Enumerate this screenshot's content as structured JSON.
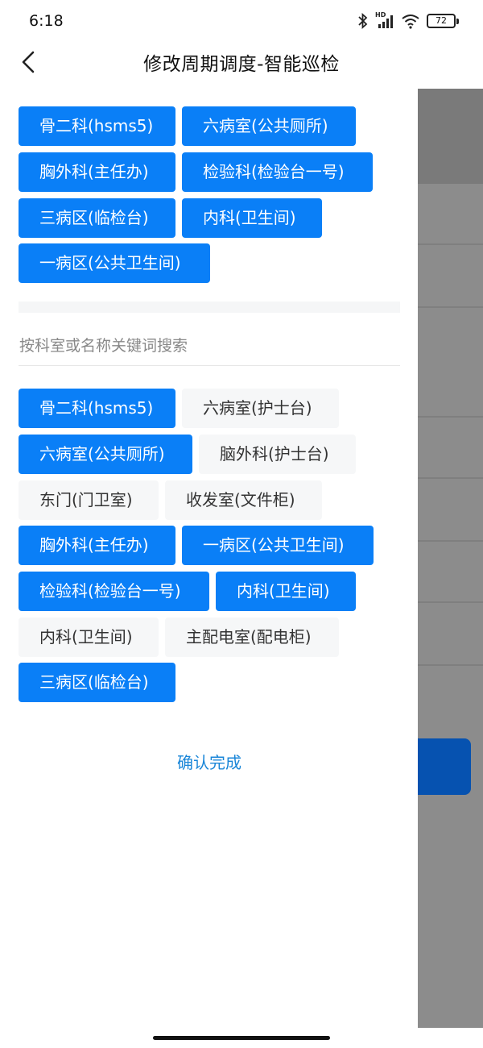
{
  "status": {
    "time": "6:18",
    "battery": "72",
    "network_badge": "HD"
  },
  "header": {
    "title": "修改周期调度-智能巡检"
  },
  "selected_chips": [
    "骨二科(hsms5)",
    "六病室(公共厕所)",
    "胸外科(主任办)",
    "检验科(检验台一号)",
    "三病区(临检台)",
    "内科(卫生间)",
    "一病区(公共卫生间)"
  ],
  "search": {
    "placeholder": "按科室或名称关键词搜索"
  },
  "options": [
    {
      "label": "骨二科(hsms5)",
      "selected": true
    },
    {
      "label": "六病室(护士台)",
      "selected": false
    },
    {
      "label": "六病室(公共厕所)",
      "selected": true
    },
    {
      "label": "脑外科(护士台)",
      "selected": false
    },
    {
      "label": "东门(门卫室)",
      "selected": false
    },
    {
      "label": "收发室(文件柜)",
      "selected": false
    },
    {
      "label": "胸外科(主任办)",
      "selected": true
    },
    {
      "label": "一病区(公共卫生间)",
      "selected": true
    },
    {
      "label": "检验科(检验台一号)",
      "selected": true
    },
    {
      "label": "内科(卫生间)",
      "selected": true
    },
    {
      "label": "内科(卫生间)",
      "selected": false
    },
    {
      "label": "主配电室(配电柜)",
      "selected": false
    },
    {
      "label": "三病区(临检台)",
      "selected": true
    }
  ],
  "actions": {
    "confirm_label": "确认完成"
  },
  "colors": {
    "accent": "#0a7ff7",
    "chip_off_bg": "#f6f7f8",
    "confirm_text": "#1a86d8",
    "overlay": "#8c8c8c"
  }
}
